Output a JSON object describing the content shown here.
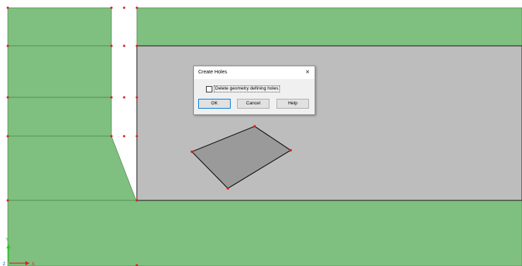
{
  "dialog": {
    "title": "Create Holes",
    "close_glyph": "×",
    "checkbox_label": "Delete geometry defining holes",
    "checkbox_checked": false,
    "ok_label": "OK",
    "cancel_label": "Cancel",
    "help_label": "Help"
  },
  "axes": {
    "y_label": "Y",
    "z_label": "Z",
    "x_label": "X"
  },
  "colors": {
    "region_fill": "#7fbf7f",
    "plate_fill": "#bdbdbd",
    "hole_fill": "#9a9a9a",
    "node_color": "#d62020",
    "axis_y": "#22cc22",
    "axis_x": "#dd2222"
  },
  "icons": [
    "close-icon",
    "x-axis-icon",
    "y-axis-icon"
  ]
}
